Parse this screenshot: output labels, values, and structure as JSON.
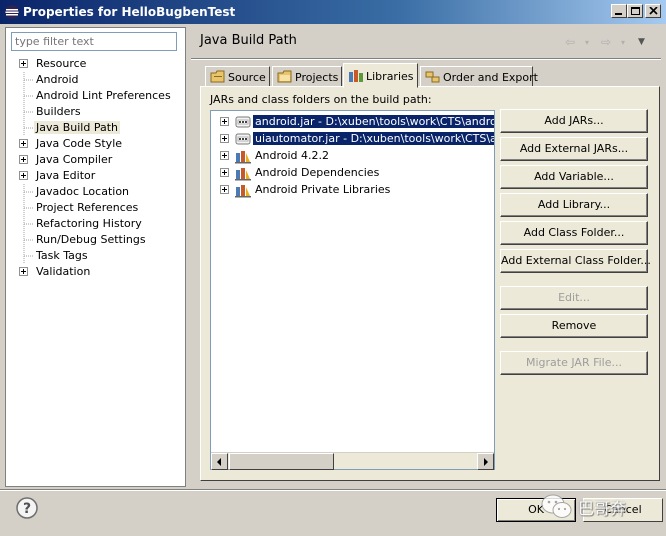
{
  "window": {
    "title": "Properties for HelloBugbenTest"
  },
  "filter": {
    "placeholder": "type filter text"
  },
  "tree": [
    {
      "label": "Resource",
      "expandable": true
    },
    {
      "label": "Android",
      "expandable": false
    },
    {
      "label": "Android Lint Preferences",
      "expandable": false
    },
    {
      "label": "Builders",
      "expandable": false
    },
    {
      "label": "Java Build Path",
      "expandable": false,
      "selected": true
    },
    {
      "label": "Java Code Style",
      "expandable": true
    },
    {
      "label": "Java Compiler",
      "expandable": true
    },
    {
      "label": "Java Editor",
      "expandable": true
    },
    {
      "label": "Javadoc Location",
      "expandable": false
    },
    {
      "label": "Project References",
      "expandable": false
    },
    {
      "label": "Refactoring History",
      "expandable": false
    },
    {
      "label": "Run/Debug Settings",
      "expandable": false
    },
    {
      "label": "Task Tags",
      "expandable": false
    },
    {
      "label": "Validation",
      "expandable": true
    }
  ],
  "page": {
    "title": "Java Build Path"
  },
  "tabs": [
    {
      "label": "Source",
      "icon": "source-folder-icon"
    },
    {
      "label": "Projects",
      "icon": "projects-folder-icon"
    },
    {
      "label": "Libraries",
      "icon": "libraries-icon",
      "active": true
    },
    {
      "label": "Order and Export",
      "icon": "order-export-icon"
    }
  ],
  "libraries": {
    "caption": "JARs and class folders on the build path:",
    "items": [
      {
        "label": "android.jar - D:\\xuben\\tools\\work\\CTS\\android-sd",
        "icon": "jar-icon",
        "selected": true
      },
      {
        "label": "uiautomator.jar - D:\\xuben\\tools\\work\\CTS\\andro",
        "icon": "jar-icon",
        "selected": true
      },
      {
        "label": "Android 4.2.2",
        "icon": "library-icon",
        "selected": false
      },
      {
        "label": "Android Dependencies",
        "icon": "library-icon",
        "selected": false
      },
      {
        "label": "Android Private Libraries",
        "icon": "library-icon",
        "selected": false
      }
    ]
  },
  "buttons": {
    "add_jars": "Add JARs...",
    "add_external_jars": "Add External JARs...",
    "add_variable": "Add Variable...",
    "add_library": "Add Library...",
    "add_class_folder": "Add Class Folder...",
    "add_external_class_folder": "Add External Class Folder...",
    "edit": "Edit...",
    "remove": "Remove",
    "migrate_jar": "Migrate JAR File..."
  },
  "dialog": {
    "ok": "OK",
    "cancel": "Cancel"
  },
  "watermark": {
    "text": "巴哥奔"
  },
  "colors": {
    "selection": "#0a246a",
    "titlebar": "#0a246a"
  }
}
